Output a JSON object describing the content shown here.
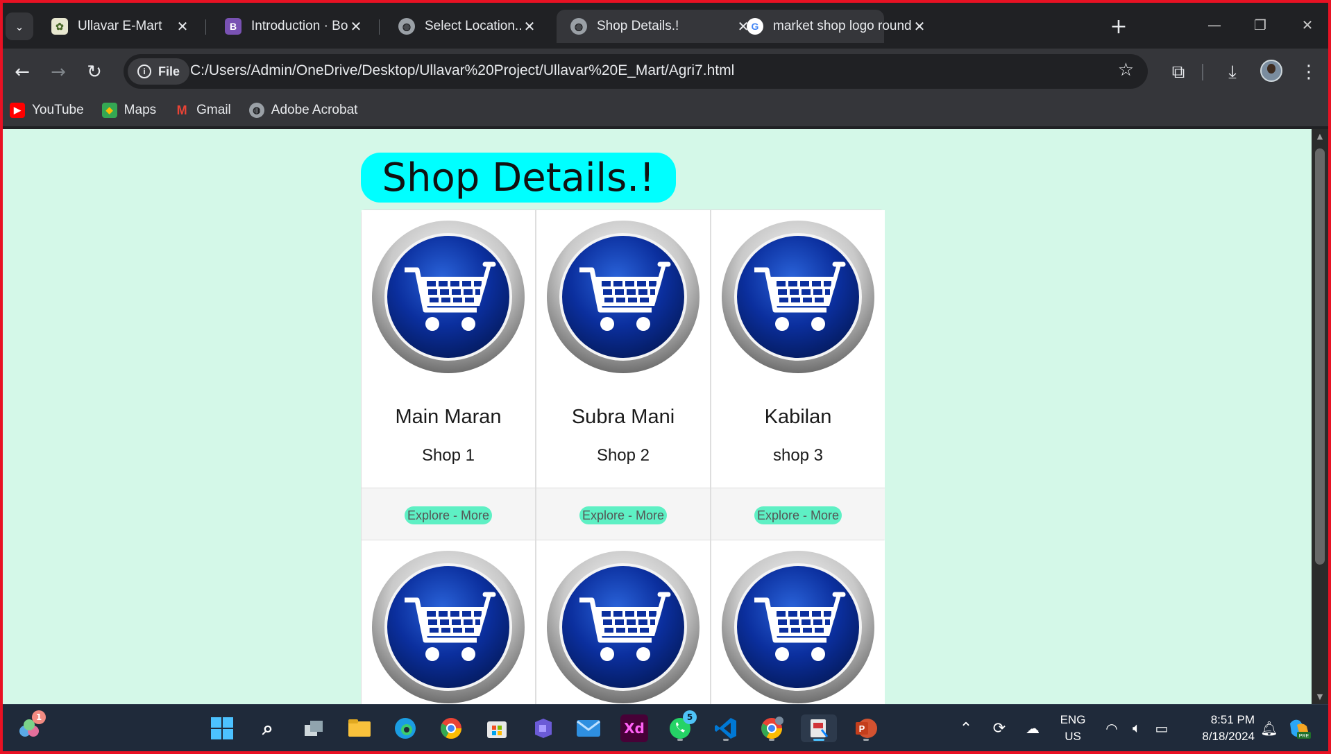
{
  "browser": {
    "tabs": [
      {
        "title": "Ullavar E-Mart",
        "favicon": "site-icon",
        "active": false
      },
      {
        "title": "Introduction · Bootstrap",
        "favicon": "bootstrap-icon",
        "active": false
      },
      {
        "title": "Select Location...",
        "favicon": "globe-icon",
        "active": false
      },
      {
        "title": "Shop Details.!",
        "favicon": "globe-icon",
        "active": true
      },
      {
        "title": "market shop logo round",
        "favicon": "google-icon",
        "active": false
      }
    ],
    "address": {
      "chip_label": "File",
      "url": "C:/Users/Admin/OneDrive/Desktop/Ullavar%20Project/Ullavar%20E_Mart/Agri7.html"
    },
    "bookmarks": [
      {
        "label": "YouTube",
        "icon": "youtube-icon"
      },
      {
        "label": "Maps",
        "icon": "maps-icon"
      },
      {
        "label": "Gmail",
        "icon": "gmail-icon"
      },
      {
        "label": "Adobe Acrobat",
        "icon": "globe-icon"
      }
    ]
  },
  "page": {
    "heading": "Shop Details.!",
    "background": "#d4f8e8",
    "heading_color": "#00ffff",
    "button_color": "#5ef0c4",
    "shops": [
      {
        "owner": "Main Maran",
        "shop": "Shop 1",
        "button": "Explore - More"
      },
      {
        "owner": "Subra Mani",
        "shop": "Shop 2",
        "button": "Explore - More"
      },
      {
        "owner": "Kabilan",
        "shop": "shop 3",
        "button": "Explore - More"
      }
    ]
  },
  "taskbar": {
    "copilot_badge": "1",
    "whatsapp_badge": "5",
    "lang_line1": "ENG",
    "lang_line2": "US",
    "time": "8:51 PM",
    "date": "8/18/2024"
  }
}
